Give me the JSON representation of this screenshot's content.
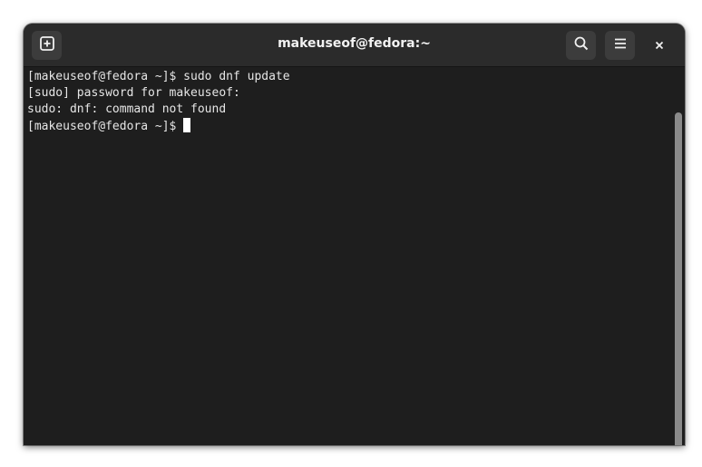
{
  "window": {
    "title": "makeuseof@fedora:~"
  },
  "header": {
    "new_tab_icon": "new-tab-icon",
    "search_icon": "search-icon",
    "menu_icon": "menu-icon",
    "close_icon": "close-icon"
  },
  "terminal": {
    "lines": [
      "[makeuseof@fedora ~]$ sudo dnf update",
      "[sudo] password for makeuseof:",
      "sudo: dnf: command not found",
      "[makeuseof@fedora ~]$"
    ]
  },
  "colors": {
    "terminal_bg": "#1e1e1e",
    "headerbar_bg": "#2b2b2b",
    "text": "#e6e6e6"
  }
}
